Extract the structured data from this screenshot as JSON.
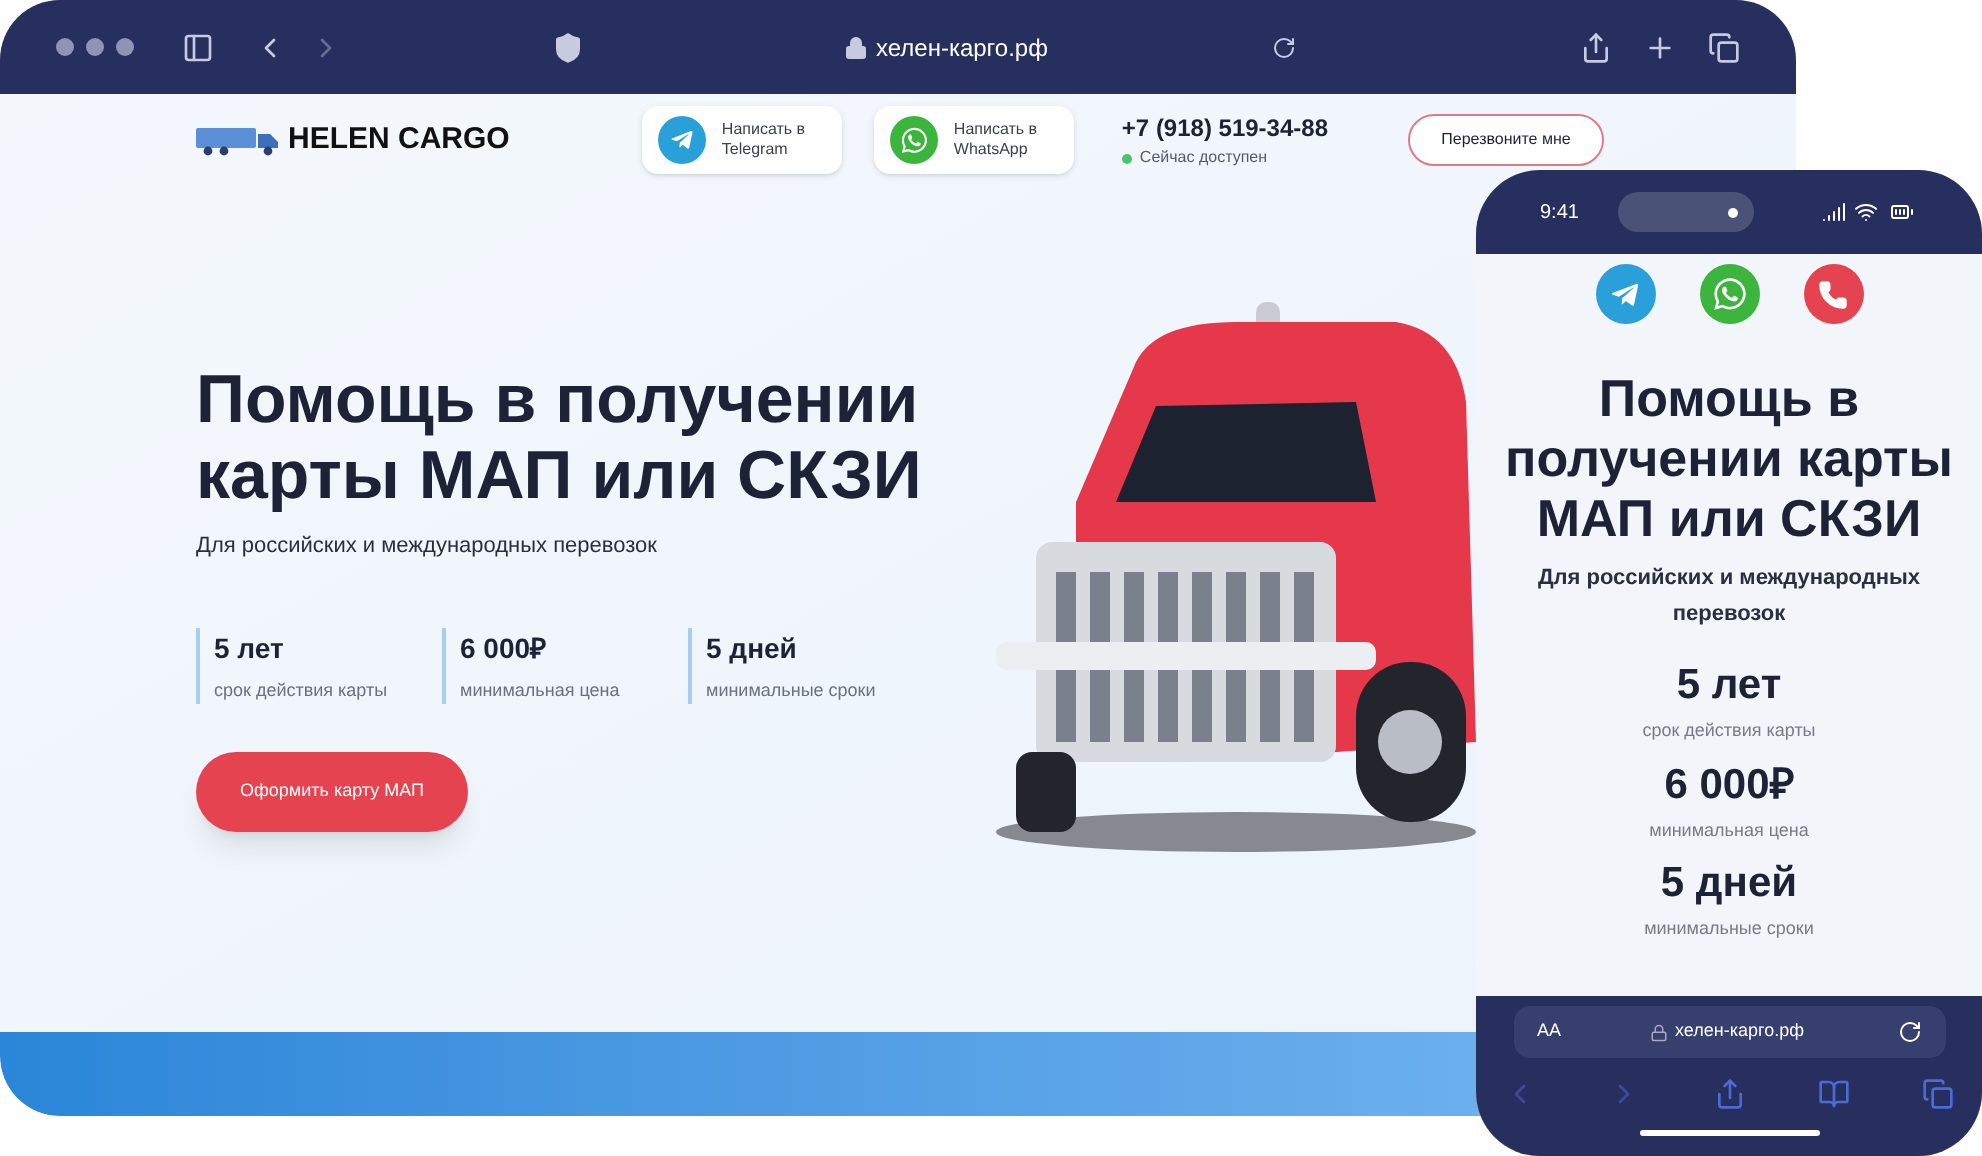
{
  "browser": {
    "url": "хелен-карго.рф"
  },
  "header": {
    "logo": "HELEN CARGO",
    "messengers": [
      {
        "kind": "telegram",
        "label": "Написать в Telegram"
      },
      {
        "kind": "whatsapp",
        "label": "Написать в WhatsApp"
      }
    ],
    "phone": "+7 (918) 519-34-88",
    "status": "Сейчас доступен",
    "online": true,
    "callback_button": "Перезвоните мне"
  },
  "hero": {
    "title": "Помощь в получении карты МАП или СКЗИ",
    "subtitle": "Для российских и международных перевозок",
    "stats": [
      {
        "value": "5 лет",
        "caption": "срок действия карты"
      },
      {
        "value": "6 000₽",
        "caption": "минимальная цена"
      },
      {
        "value": "5 дней",
        "caption": "минимальные сроки"
      }
    ],
    "cta": "Оформить карту МАП"
  },
  "phone": {
    "time": "9:41",
    "contacts": [
      {
        "kind": "telegram"
      },
      {
        "kind": "whatsapp"
      },
      {
        "kind": "call"
      }
    ],
    "title": "Помощь в получении карты МАП или СКЗИ",
    "subtitle": "Для российских и международных перевозок",
    "stats": [
      {
        "value": "5 лет",
        "caption": "срок действия карты"
      },
      {
        "value": "6 000₽",
        "caption": "минимальная цена"
      },
      {
        "value": "5 дней",
        "caption": "минимальные сроки"
      }
    ],
    "text_size": "AA",
    "url": "хелен-карго.рф"
  }
}
